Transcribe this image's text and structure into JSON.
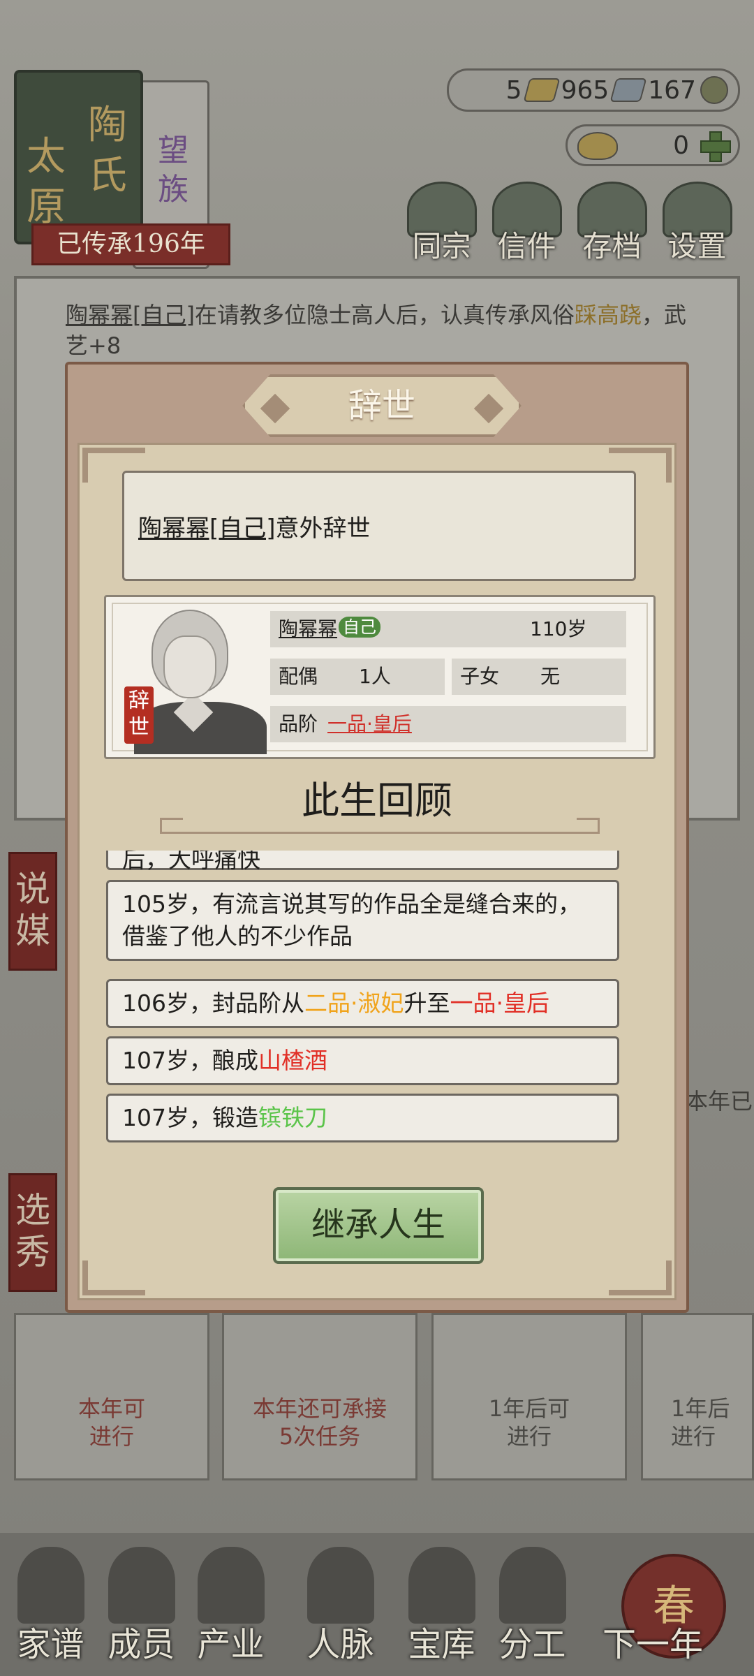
{
  "header": {
    "clan_book": {
      "place": [
        "太",
        "原"
      ],
      "family": [
        "陶",
        "氏"
      ],
      "rank": [
        "望",
        "族"
      ],
      "heritage": "已传承196年"
    },
    "resources": [
      {
        "value": "5",
        "icon": "gold-bar-icon"
      },
      {
        "value": "965",
        "icon": "silver-bar-icon"
      },
      {
        "value": "167",
        "icon": "copper-coin-icon"
      }
    ],
    "ingot": {
      "value": "0",
      "icon": "gold-ingot-icon"
    },
    "top_buttons": [
      {
        "label": "同宗",
        "icon": "clan-books-icon"
      },
      {
        "label": "信件",
        "icon": "letter-icon"
      },
      {
        "label": "存档",
        "icon": "brush-scroll-icon"
      },
      {
        "label": "设置",
        "icon": "gear-icon"
      }
    ]
  },
  "log": {
    "name": "陶幂幂[自己]",
    "text": "在请教多位隐士高人后，认真传承风俗",
    "highlight": "踩高跷",
    "suffix": "，武艺+8"
  },
  "side_tags": [
    "说媒",
    "选秀"
  ],
  "cards": [
    {
      "line1": "本年可",
      "line2": "进行"
    },
    {
      "line1": "本年还可承接",
      "line2": "5次任务"
    },
    {
      "line1": "1年后可",
      "line2": "进行"
    },
    {
      "line1": "1年后",
      "line2": "进行"
    }
  ],
  "partial_text": "本年已",
  "bottom_nav": [
    {
      "label": "家谱",
      "icon": "family-tree-icon"
    },
    {
      "label": "成员",
      "icon": "members-icon"
    },
    {
      "label": "产业",
      "icon": "industry-icon"
    },
    {
      "label": "人脉",
      "icon": "network-icon"
    },
    {
      "label": "宝库",
      "icon": "treasury-icon"
    },
    {
      "label": "分工",
      "icon": "division-scroll-icon"
    },
    {
      "label": "下一年",
      "icon": "spring-lantern-icon"
    }
  ],
  "lantern_char": "春",
  "modal": {
    "title": "辞世",
    "event": {
      "name": "陶幂幂[自己]",
      "text": "意外辞世"
    },
    "profile": {
      "name": "陶幂幂",
      "badge": "自己",
      "age": "110岁",
      "spouse_label": "配偶",
      "spouse_value": "1人",
      "children_label": "子女",
      "children_value": "无",
      "rank_label": "品阶",
      "rank_value": "一品·皇后",
      "seal": [
        "辞",
        "世"
      ]
    },
    "review_title": "此生回顾",
    "review_items": [
      {
        "parts": [
          {
            "t": "后，大呼痛快",
            "c": ""
          }
        ]
      },
      {
        "parts": [
          {
            "t": "105岁，有流言说其写的作品全是缝合来的，借鉴了他人的不少作品",
            "c": ""
          }
        ]
      },
      {
        "parts": [
          {
            "t": "106岁，封品阶从",
            "c": ""
          },
          {
            "t": "二品·淑妃",
            "c": "orange"
          },
          {
            "t": "升至",
            "c": ""
          },
          {
            "t": "一品·皇后",
            "c": "red"
          }
        ]
      },
      {
        "parts": [
          {
            "t": "107岁，酿成",
            "c": ""
          },
          {
            "t": "山楂酒",
            "c": "red"
          }
        ]
      },
      {
        "parts": [
          {
            "t": "107岁，锻造",
            "c": ""
          },
          {
            "t": "镔铁刀",
            "c": "green"
          }
        ]
      }
    ],
    "button": "继承人生"
  }
}
